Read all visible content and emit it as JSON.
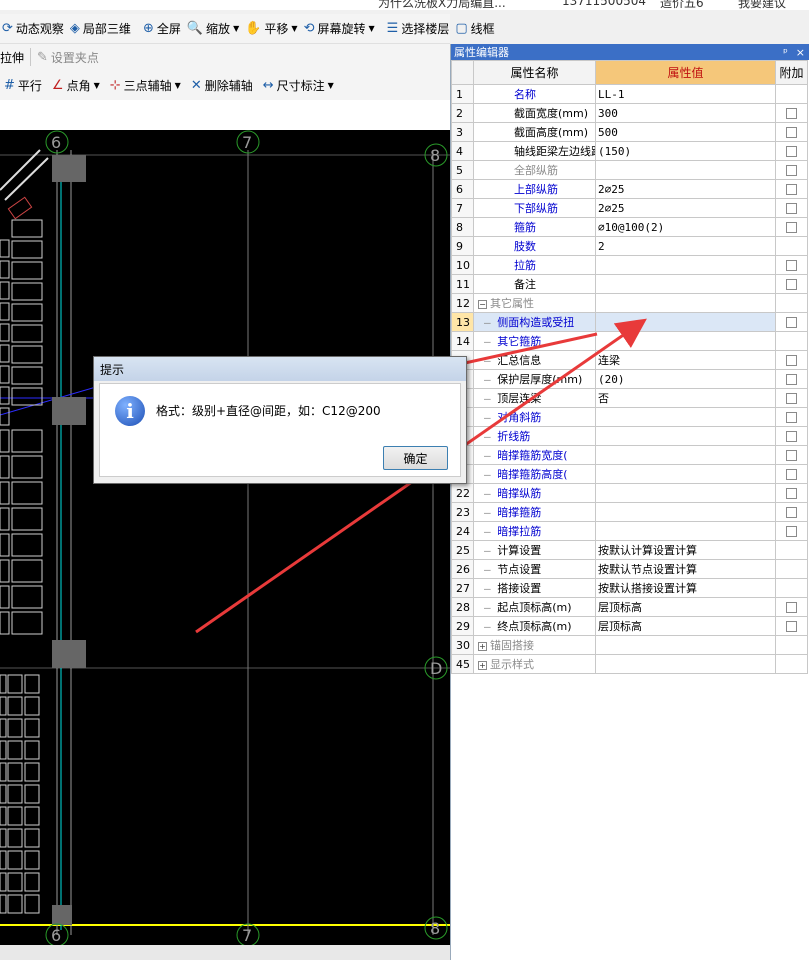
{
  "topbar": {
    "fragment1": "为什么洗板X力局编直...",
    "fragment2": "13711500504",
    "fragment3": "造价五6",
    "fragment4": "我要建议"
  },
  "toolbar1": [
    {
      "label": "动态观察",
      "icon": "orbit-icon"
    },
    {
      "label": "局部三维",
      "icon": "3d-view-icon"
    },
    {
      "label": "全屏",
      "icon": "fullscreen-icon"
    },
    {
      "label": "缩放",
      "icon": "zoom-icon"
    },
    {
      "label": "平移",
      "icon": "pan-icon"
    },
    {
      "label": "屏幕旋转",
      "icon": "rotate-icon"
    },
    {
      "label": "选择楼层",
      "icon": "floor-icon"
    },
    {
      "label": "线框",
      "icon": "wireframe-icon"
    }
  ],
  "toolbar2": {
    "stretch": "拉伸",
    "grip": "设置夹点"
  },
  "toolbar3": [
    {
      "label": "平行",
      "icon": "parallel-icon"
    },
    {
      "label": "点角",
      "icon": "point-angle-icon"
    },
    {
      "label": "三点辅轴",
      "icon": "three-point-axis-icon"
    },
    {
      "label": "删除辅轴",
      "icon": "delete-axis-icon"
    },
    {
      "label": "尺寸标注",
      "icon": "dimension-icon"
    }
  ],
  "canvas": {
    "axis_top": [
      "6",
      "7",
      "8"
    ],
    "axis_bottom": [
      "6",
      "7",
      "8"
    ],
    "axis_side": "D"
  },
  "panel": {
    "title": "属性编辑器",
    "pin": "ᵖ",
    "close": "×",
    "headers": {
      "name": "属性名称",
      "value": "属性值",
      "extra": "附加"
    },
    "rows": [
      {
        "num": "1",
        "name": "名称",
        "value": "LL-1",
        "style": "blue",
        "checkbox": false
      },
      {
        "num": "2",
        "name": "截面宽度(mm)",
        "value": "300",
        "style": "black",
        "checkbox": true
      },
      {
        "num": "3",
        "name": "截面高度(mm)",
        "value": "500",
        "style": "black",
        "checkbox": true
      },
      {
        "num": "4",
        "name": "轴线距梁左边线距",
        "value": "(150)",
        "style": "black",
        "checkbox": true
      },
      {
        "num": "5",
        "name": "全部纵筋",
        "value": "",
        "style": "gray",
        "checkbox": true
      },
      {
        "num": "6",
        "name": "上部纵筋",
        "value": "2⌀25",
        "style": "blue",
        "checkbox": true
      },
      {
        "num": "7",
        "name": "下部纵筋",
        "value": "2⌀25",
        "style": "blue",
        "checkbox": true
      },
      {
        "num": "8",
        "name": "箍筋",
        "value": "⌀10@100(2)",
        "style": "blue",
        "checkbox": true
      },
      {
        "num": "9",
        "name": "肢数",
        "value": "2",
        "style": "blue",
        "checkbox": false
      },
      {
        "num": "10",
        "name": "拉筋",
        "value": "",
        "style": "blue",
        "checkbox": true
      },
      {
        "num": "11",
        "name": "备注",
        "value": "",
        "style": "black",
        "checkbox": true
      },
      {
        "num": "12",
        "name": "其它属性",
        "value": "",
        "style": "group",
        "checkbox": false
      },
      {
        "num": "13",
        "name": "侧面构造或受扭",
        "value": "",
        "style": "blue-child",
        "checkbox": true,
        "selected": true
      },
      {
        "num": "14",
        "name": "其它箍筋",
        "value": "",
        "style": "blue-child",
        "checkbox": false
      },
      {
        "num": "",
        "name": "汇总信息",
        "value": "连梁",
        "style": "child",
        "checkbox": true
      },
      {
        "num": "",
        "name": "保护层厚度(mm)",
        "value": "(20)",
        "style": "child",
        "checkbox": true
      },
      {
        "num": "",
        "name": "顶层连梁",
        "value": "否",
        "style": "child",
        "checkbox": true
      },
      {
        "num": "",
        "name": "对角斜筋",
        "value": "",
        "style": "blue-child",
        "checkbox": true
      },
      {
        "num": "",
        "name": "折线筋",
        "value": "",
        "style": "blue-child",
        "checkbox": true
      },
      {
        "num": "",
        "name": "暗撑箍筋宽度(",
        "value": "",
        "style": "blue-child",
        "checkbox": true
      },
      {
        "num": "",
        "name": "暗撑箍筋高度(",
        "value": "",
        "style": "blue-child",
        "checkbox": true
      },
      {
        "num": "22",
        "name": "暗撑纵筋",
        "value": "",
        "style": "blue-child",
        "checkbox": true
      },
      {
        "num": "23",
        "name": "暗撑箍筋",
        "value": "",
        "style": "blue-child",
        "checkbox": true
      },
      {
        "num": "24",
        "name": "暗撑拉筋",
        "value": "",
        "style": "blue-child",
        "checkbox": true
      },
      {
        "num": "25",
        "name": "计算设置",
        "value": "按默认计算设置计算",
        "style": "child",
        "checkbox": false
      },
      {
        "num": "26",
        "name": "节点设置",
        "value": "按默认节点设置计算",
        "style": "child",
        "checkbox": false
      },
      {
        "num": "27",
        "name": "搭接设置",
        "value": "按默认搭接设置计算",
        "style": "child",
        "checkbox": false
      },
      {
        "num": "28",
        "name": "起点顶标高(m)",
        "value": "层顶标高",
        "style": "child",
        "checkbox": true
      },
      {
        "num": "29",
        "name": "终点顶标高(m)",
        "value": "层顶标高",
        "style": "child",
        "checkbox": true
      },
      {
        "num": "30",
        "name": "锚固搭接",
        "value": "",
        "style": "collapsed",
        "checkbox": false
      },
      {
        "num": "45",
        "name": "显示样式",
        "value": "",
        "style": "collapsed",
        "checkbox": false
      }
    ]
  },
  "dialog": {
    "title": "提示",
    "message": "格式：级别+直径@间距，如：C12@200",
    "ok": "确定",
    "icon": "info-icon"
  },
  "colors": {
    "annotation_arrow": "#e83a3a",
    "panel_title_bg": "#3b6fc6",
    "value_header_bg": "#f5c77a"
  }
}
